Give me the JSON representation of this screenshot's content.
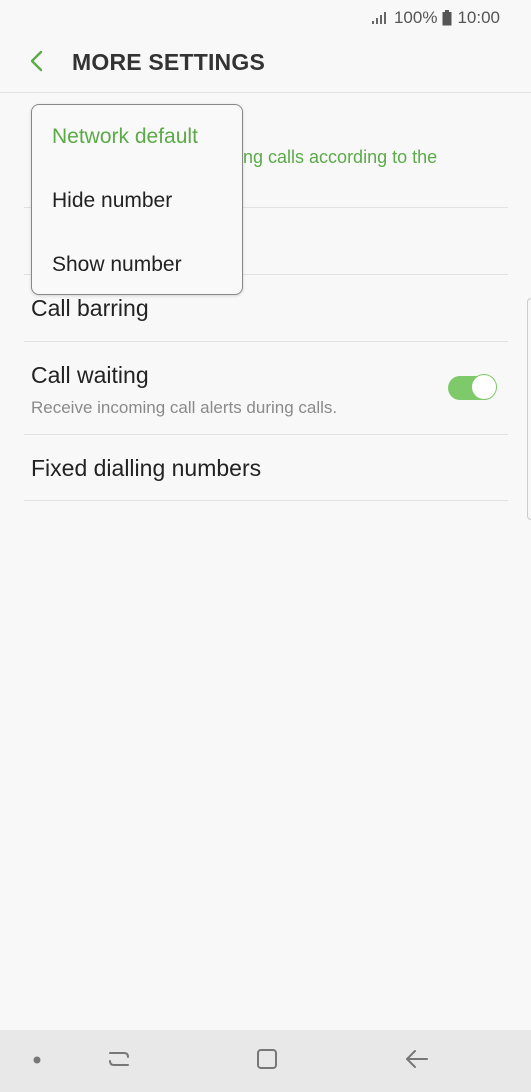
{
  "status_bar": {
    "battery": "100%",
    "time": "10:00",
    "icons": [
      "signal-icon",
      "battery-icon"
    ]
  },
  "header": {
    "title": "MORE SETTINGS",
    "back_icon": "chevron-left-icon"
  },
  "settings": [
    {
      "title": "",
      "subtitle": "oing calls according to the"
    },
    {
      "title": "",
      "subtitle": ""
    },
    {
      "title": "Call barring"
    },
    {
      "title": "Call waiting",
      "subtitle": "Receive incoming call alerts during calls.",
      "toggle_on": true
    },
    {
      "title": "Fixed dialling numbers"
    }
  ],
  "dropdown": {
    "options": [
      "Network default",
      "Hide number",
      "Show number"
    ],
    "selected_index": 0
  },
  "nav_bar": {
    "items": [
      "dot-icon",
      "recent-apps-icon",
      "home-icon",
      "back-icon"
    ]
  },
  "colors": {
    "accent": "#5aab47",
    "toggle": "#7ec96a",
    "background": "#f8f8f8",
    "nav_background": "#e8e8e8"
  }
}
